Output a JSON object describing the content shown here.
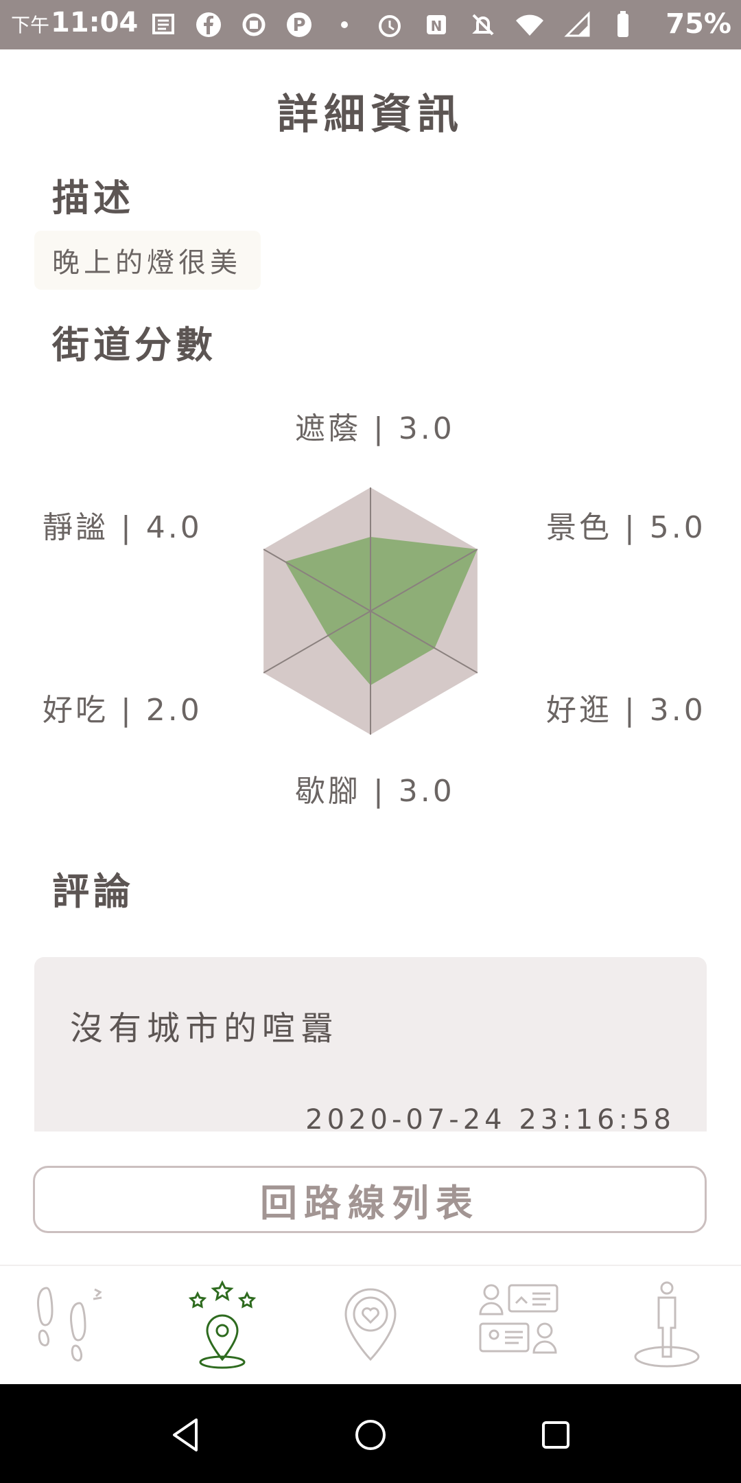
{
  "status_bar": {
    "ampm": "下午",
    "time": "11:04",
    "battery": "75%",
    "left_icons": [
      "news-icon",
      "facebook-icon",
      "sync-icon",
      "pinterest-icon",
      "dot-icon"
    ],
    "right_icons": [
      "alarm-icon",
      "nfc-icon",
      "mute-icon",
      "wifi-icon",
      "signal-icon",
      "battery-icon"
    ]
  },
  "header": {
    "title": "詳細資訊"
  },
  "description": {
    "heading": "描述",
    "text": "晚上的燈很美"
  },
  "scores": {
    "heading": "街道分數",
    "labels": {
      "shade": "遮蔭 | 3.0",
      "scenery": "景色 | 5.0",
      "shopping": "好逛 | 3.0",
      "rest": "歇腳 | 3.0",
      "food": "好吃 | 2.0",
      "quiet": "靜謐 | 4.0"
    }
  },
  "chart_data": {
    "type": "radar",
    "categories": [
      "遮蔭",
      "景色",
      "好逛",
      "歇腳",
      "好吃",
      "靜謐"
    ],
    "values": [
      3.0,
      5.0,
      3.0,
      3.0,
      2.0,
      4.0
    ],
    "max": 5.0,
    "colors": {
      "background": "#d5c9c8",
      "fill": "#8eae77",
      "axis": "#8a807e"
    }
  },
  "comments": {
    "heading": "評論",
    "items": [
      {
        "text": "沒有城市的喧囂",
        "time": "2020-07-24 23:16:58"
      }
    ]
  },
  "back_button": {
    "label": "回路線列表"
  },
  "tabbar": {
    "active_color": "#2e6b1f",
    "inactive_color": "#c5bebd",
    "tabs": [
      {
        "icon": "footsteps-icon",
        "active": false
      },
      {
        "icon": "star-location-icon",
        "active": true
      },
      {
        "icon": "heart-location-icon",
        "active": false
      },
      {
        "icon": "people-cards-icon",
        "active": false
      },
      {
        "icon": "person-standing-icon",
        "active": false
      }
    ]
  },
  "navbar": {
    "icons": [
      "back-triangle-icon",
      "home-circle-icon",
      "recents-square-icon"
    ]
  }
}
